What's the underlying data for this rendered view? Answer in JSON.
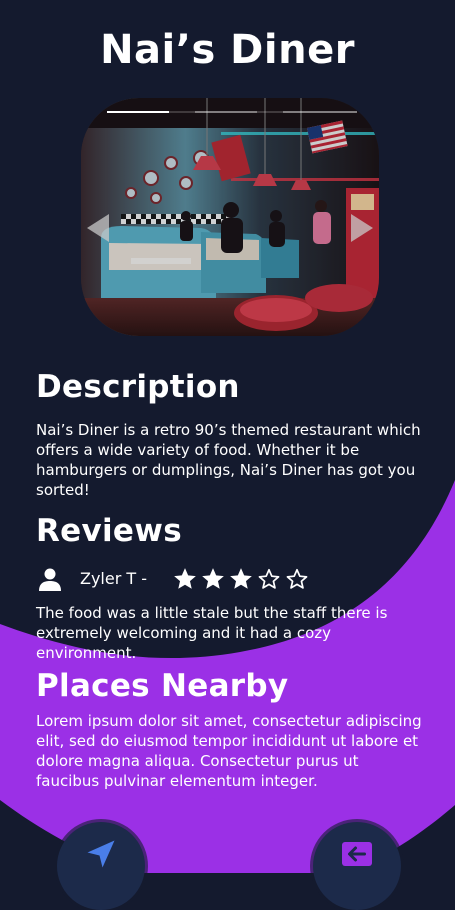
{
  "app": {
    "title": "Nai’s Diner"
  },
  "carousel": {
    "image_alt": "retro diner interior",
    "slide_count": 3,
    "active_slide": 1,
    "prev_icon": "chevron-left-icon",
    "next_icon": "chevron-right-icon"
  },
  "description": {
    "heading": "Description",
    "body": "Nai’s Diner is a retro 90’s themed restaurant which offers a wide variety of food. Whether it be hamburgers or dumplings, Nai’s Diner has got you sorted!"
  },
  "reviews": {
    "heading": "Reviews",
    "items": [
      {
        "author": "Zyler T -",
        "avatar_icon": "user-icon",
        "rating": 3,
        "max_rating": 5,
        "text": "The food was a little stale but the staff there is extremely welcoming and it had a cozy environment."
      }
    ]
  },
  "nearby": {
    "heading": "Places Nearby",
    "body": "Lorem ipsum dolor sit amet, consectetur adipiscing elit, sed do eiusmod tempor incididunt ut labore et dolore magna aliqua. Consectetur purus ut faucibus pulvinar elementum integer."
  },
  "actions": {
    "left_icon": "send-icon",
    "right_icon": "back-arrow-icon"
  },
  "colors": {
    "background": "#141a2e",
    "accent": "#9b30e6",
    "fab": "#1c2a4a",
    "text": "#ffffff"
  }
}
